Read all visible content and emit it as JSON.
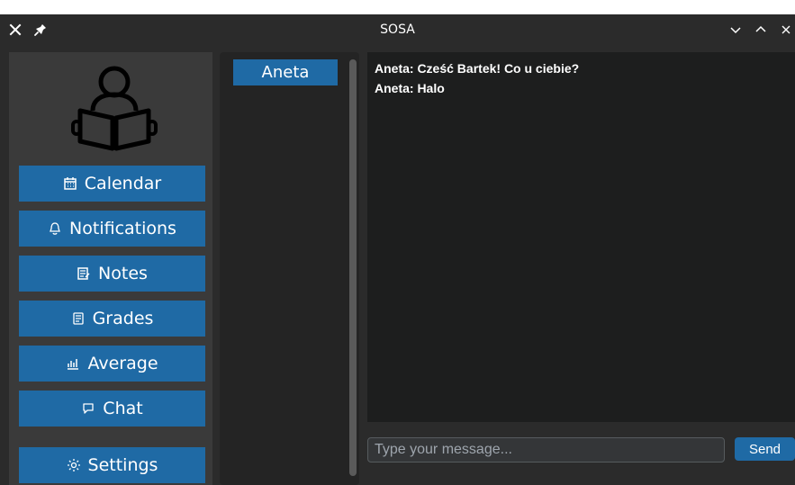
{
  "window": {
    "title": "SOSA",
    "accent": "#1f6aa5",
    "background": "#2b2b2b",
    "message_background": "#1d1e1e"
  },
  "titlebar": {
    "close_icon": "close-icon",
    "pin_icon": "pin-icon",
    "minimize_icon": "chevron-down-icon",
    "maximize_icon": "chevron-up-icon",
    "window_close_icon": "close-icon"
  },
  "sidebar": {
    "logo_icon": "reading-person-icon",
    "items": [
      {
        "label": "Calendar",
        "icon": "calendar-icon"
      },
      {
        "label": "Notifications",
        "icon": "bell-icon"
      },
      {
        "label": "Notes",
        "icon": "note-icon"
      },
      {
        "label": "Grades",
        "icon": "grades-icon"
      },
      {
        "label": "Average",
        "icon": "chart-icon"
      },
      {
        "label": "Chat",
        "icon": "chat-icon"
      },
      {
        "label": "Settings",
        "icon": "gear-icon"
      }
    ]
  },
  "contacts": {
    "items": [
      {
        "label": "Aneta"
      }
    ]
  },
  "chat": {
    "messages": [
      {
        "text": "Aneta: Cześć Bartek! Co u ciebie?"
      },
      {
        "text": "Aneta: Halo"
      }
    ],
    "input": {
      "value": "",
      "placeholder": "Type your message..."
    },
    "send_label": "Send"
  }
}
